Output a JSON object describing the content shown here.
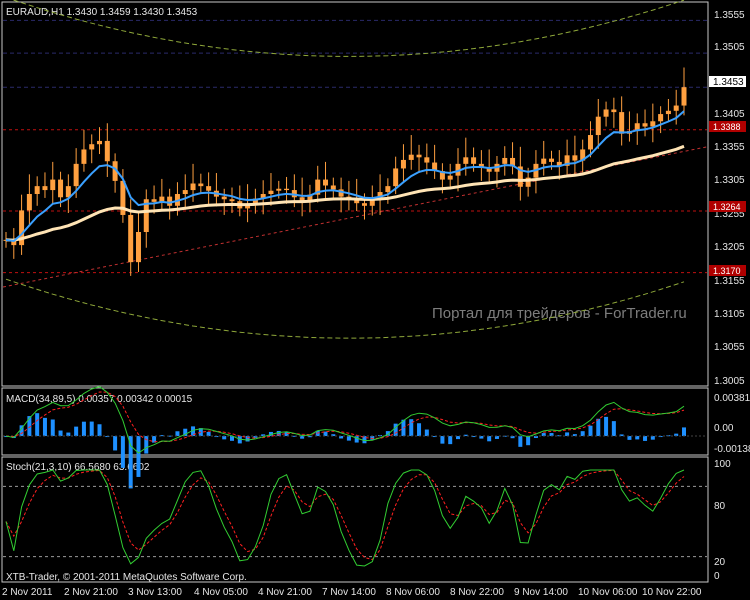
{
  "header": {
    "symbol_info": "EURAUD,H1  1.3430 1.3459 1.3430 1.3453",
    "macd_info": "MACD(34,89,5) 0.00357 0.00342 0.00015",
    "stoch_info": "Stoch(21,3,10) 66.5680 63.6602"
  },
  "watermark": "Портал для трейдеров - ForTrader.ru",
  "copyright": "XTB-Trader, © 2001-2011 MetaQuotes Software Corp.",
  "colors": {
    "background": "#000000",
    "candles": "#ffa040",
    "ma_fast": "#3aa0ff",
    "ma_slow": "#ffe4b5",
    "envelope": "#8fa83a",
    "level_line": "#c01010",
    "trendline": "#c03030",
    "macd_hist": "#1e90ff",
    "macd_signal": "#ff2020",
    "macd_line": "#32cd32",
    "stoch_main": "#32cd32",
    "stoch_signal": "#ff2020",
    "axis_text": "#e6e6e6",
    "tag_bg": "#b00000"
  },
  "chart_data": [
    {
      "type": "candlestick",
      "symbol": "EURAUD",
      "timeframe": "H1",
      "ylim": [
        1.3,
        1.358
      ],
      "y_ticks": [
        "1.3555",
        "1.3505",
        "1.3405",
        "1.3355",
        "1.3305",
        "1.3255",
        "1.3205",
        "1.3155",
        "1.3105",
        "1.3055",
        "1.3005"
      ],
      "current_price": "1.3453",
      "levels": [
        {
          "label": "1.3388",
          "value": 1.3388
        },
        {
          "label": "1.3264",
          "value": 1.3264
        },
        {
          "label": "1.3170",
          "value": 1.317
        }
      ],
      "close_series": [
        1.322,
        1.3212,
        1.3265,
        1.329,
        1.3302,
        1.3296,
        1.3312,
        1.3285,
        1.3302,
        1.3336,
        1.3358,
        1.3366,
        1.3371,
        1.334,
        1.331,
        1.3258,
        1.3186,
        1.3232,
        1.3282,
        1.3278,
        1.3286,
        1.3272,
        1.329,
        1.3296,
        1.3306,
        1.3302,
        1.3295,
        1.3286,
        1.3282,
        1.3279,
        1.3268,
        1.3275,
        1.3283,
        1.329,
        1.3295,
        1.3298,
        1.3296,
        1.3285,
        1.328,
        1.3289,
        1.3312,
        1.3303,
        1.3297,
        1.3286,
        1.3283,
        1.3276,
        1.3272,
        1.3282,
        1.3293,
        1.3302,
        1.3329,
        1.3342,
        1.335,
        1.3346,
        1.3338,
        1.3325,
        1.3312,
        1.3318,
        1.3336,
        1.3346,
        1.3336,
        1.3331,
        1.3324,
        1.3336,
        1.3345,
        1.3332,
        1.3301,
        1.3315,
        1.3336,
        1.3344,
        1.3339,
        1.3333,
        1.3349,
        1.3341,
        1.3358,
        1.338,
        1.3408,
        1.3419,
        1.3415,
        1.3382,
        1.3386,
        1.3398,
        1.3393,
        1.3401,
        1.3412,
        1.3417,
        1.3425,
        1.3453
      ],
      "series": [
        {
          "name": "Moving Average (fast)"
        },
        {
          "name": "Moving Average (slow)"
        },
        {
          "name": "Envelope"
        }
      ]
    },
    {
      "type": "line",
      "indicator": "MACD(34,89,5)",
      "values": {
        "main": 0.00357,
        "signal": 0.00342,
        "histogram": 0.00015
      },
      "y_ticks": [
        "0.00381",
        "0.00",
        "-0.00138"
      ],
      "ylim": [
        -0.00138,
        0.00381
      ]
    },
    {
      "type": "line",
      "indicator": "Stoch(21,3,10)",
      "values": {
        "main": 66.568,
        "signal": 63.6602
      },
      "y_ticks": [
        "100",
        "80",
        "20",
        "0"
      ],
      "ylim": [
        0,
        100
      ],
      "levels": [
        80,
        20
      ]
    }
  ],
  "x_axis": {
    "tick_labels": [
      "2 Nov 2011",
      "2 Nov 21:00",
      "3 Nov 13:00",
      "4 Nov 05:00",
      "4 Nov 21:00",
      "7 Nov 14:00",
      "8 Nov 06:00",
      "8 Nov 22:00",
      "9 Nov 14:00",
      "10 Nov 06:00",
      "10 Nov 22:00"
    ]
  }
}
